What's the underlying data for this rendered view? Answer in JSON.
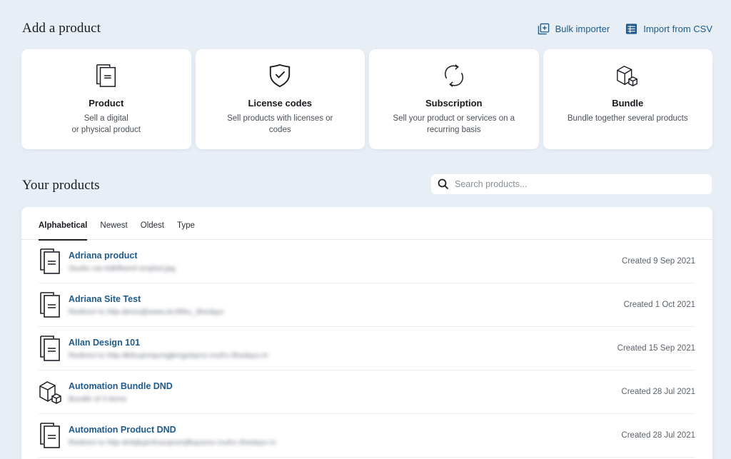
{
  "add_section": {
    "title": "Add a product",
    "links": [
      {
        "label": "Bulk importer",
        "icon": "bulk-import-icon"
      },
      {
        "label": "Import from CSV",
        "icon": "csv-table-icon"
      }
    ],
    "cards": [
      {
        "title": "Product",
        "desc": "Sell a digital\nor physical product",
        "icon": "document-stack-icon"
      },
      {
        "title": "License codes",
        "desc": "Sell products with licenses or codes",
        "icon": "shield-check-icon"
      },
      {
        "title": "Subscription",
        "desc": "Sell your product or services on a recurring basis",
        "icon": "refresh-cycle-icon"
      },
      {
        "title": "Bundle",
        "desc": "Bundle together several products",
        "icon": "boxes-icon"
      }
    ]
  },
  "products_section": {
    "title": "Your products",
    "search": {
      "placeholder": "Search products..."
    },
    "tabs": [
      {
        "label": "Alphabetical",
        "active": true
      },
      {
        "label": "Newest",
        "active": false
      },
      {
        "label": "Oldest",
        "active": false
      },
      {
        "label": "Type",
        "active": false
      }
    ],
    "items": [
      {
        "name": "Adriana product",
        "sub": "Studio cat-Adbfkwml-smplsd.jpg",
        "date": "Created 9 Sep 2021",
        "icon": "document-stack-icon"
      },
      {
        "name": "Adriana Site Test",
        "sub": "Redirect to http-demo@www.dv.ltf/ko_3hedays",
        "date": "Created 1 Oct 2021",
        "icon": "document-stack-icon"
      },
      {
        "name": "Allan Design 101",
        "sub": "Redirect to http-dkifuujnmjumgjkmgolsjmz-mufrs-3hedays-m",
        "date": "Created 15 Sep 2021",
        "icon": "document-stack-icon"
      },
      {
        "name": "Automation Bundle DND",
        "sub": "Bundle of 3 items",
        "date": "Created 28 Jul 2021",
        "icon": "boxes-icon"
      },
      {
        "name": "Automation Product DND",
        "sub": "Redirect to http-dmkjkyjmfusuqnsmjfkqusmz-mufrs-3hedays-m",
        "date": "Created 28 Jul 2021",
        "icon": "document-stack-icon"
      }
    ]
  },
  "colors": {
    "background": "#e7eef6",
    "accent": "#1e5b8c",
    "text": "#1b1f24"
  }
}
